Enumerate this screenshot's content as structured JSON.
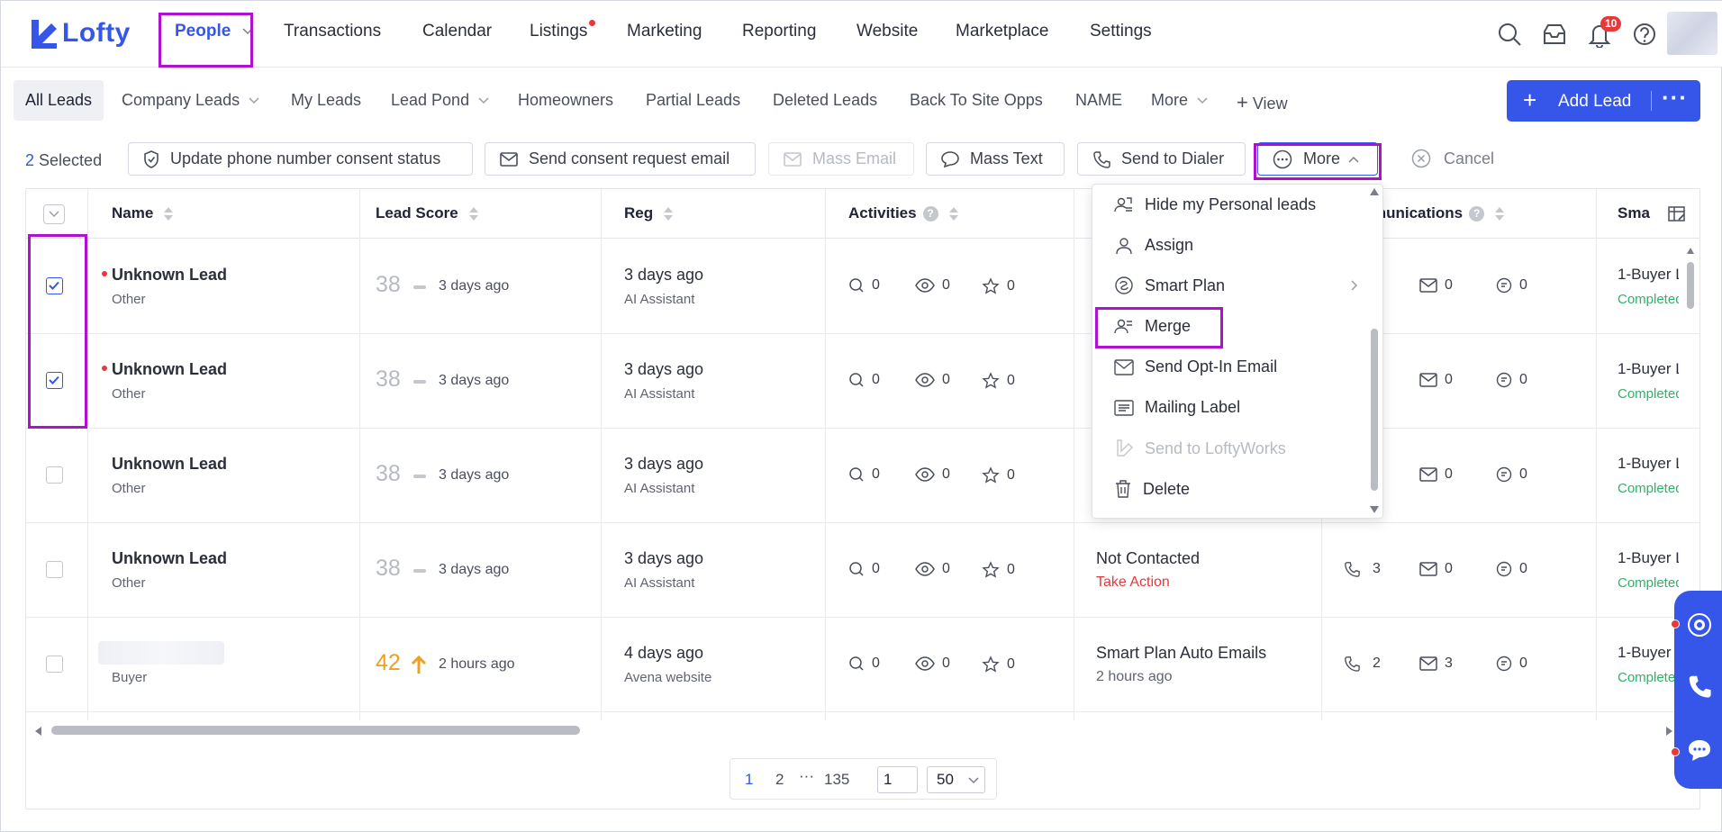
{
  "app": {
    "logo_text": "Lofty"
  },
  "nav": {
    "items": [
      "People",
      "Transactions",
      "Calendar",
      "Listings",
      "Marketing",
      "Reporting",
      "Website",
      "Marketplace",
      "Settings"
    ],
    "notification_count": "10"
  },
  "tabs": [
    "All Leads",
    "Company Leads",
    "My Leads",
    "Lead Pond",
    "Homeowners",
    "Partial Leads",
    "Deleted Leads",
    "Back To Site Opps",
    "NAME",
    "More",
    "View"
  ],
  "add_lead": {
    "label": "Add Lead"
  },
  "actions": {
    "selected_count": "2",
    "selected_label": "Selected",
    "buttons": [
      "Update phone number consent status",
      "Send consent request email",
      "Mass Email",
      "Mass Text",
      "Send to Dialer",
      "More"
    ],
    "cancel": "Cancel"
  },
  "table": {
    "headers": [
      "Name",
      "Lead Score",
      "Reg",
      "Activities",
      "munications",
      "Sma"
    ],
    "rows": [
      {
        "name": "Unknown Lead",
        "type": "Other",
        "score": "38",
        "score_time": "3 days ago",
        "reg": "3 days ago",
        "reg_source": "AI Assistant",
        "act": [
          "0",
          "0",
          "0"
        ],
        "status": "",
        "status_sub": "",
        "comm": [
          "",
          "0",
          "0"
        ],
        "sp": "1-Buyer L",
        "sp_sub": "Completed",
        "checked": true
      },
      {
        "name": "Unknown Lead",
        "type": "Other",
        "score": "38",
        "score_time": "3 days ago",
        "reg": "3 days ago",
        "reg_source": "AI Assistant",
        "act": [
          "0",
          "0",
          "0"
        ],
        "status": "",
        "status_sub": "",
        "comm": [
          "",
          "0",
          "0"
        ],
        "sp": "1-Buyer L",
        "sp_sub": "Completed",
        "checked": true
      },
      {
        "name": "Unknown Lead",
        "type": "Other",
        "score": "38",
        "score_time": "3 days ago",
        "reg": "3 days ago",
        "reg_source": "AI Assistant",
        "act": [
          "0",
          "0",
          "0"
        ],
        "status": "",
        "status_sub": "",
        "comm": [
          "",
          "0",
          "0"
        ],
        "sp": "1-Buyer L",
        "sp_sub": "Completed",
        "checked": false
      },
      {
        "name": "Unknown Lead",
        "type": "Other",
        "score": "38",
        "score_time": "3 days ago",
        "reg": "3 days ago",
        "reg_source": "AI Assistant",
        "act": [
          "0",
          "0",
          "0"
        ],
        "status": "Not Contacted",
        "status_sub": "Take Action",
        "comm": [
          "3",
          "0",
          "0"
        ],
        "sp": "1-Buyer L",
        "sp_sub": "Completed",
        "checked": false
      },
      {
        "name": "",
        "type": "Buyer",
        "score": "42",
        "score_time": "2 hours ago",
        "reg": "4 days ago",
        "reg_source": "Avena website",
        "act": [
          "0",
          "0",
          "0"
        ],
        "status": "Smart Plan Auto Emails",
        "status_sub": "2 hours ago",
        "comm": [
          "2",
          "3",
          "0"
        ],
        "sp": "1-Buyer",
        "sp_sub": "Completed",
        "checked": false
      }
    ]
  },
  "menu": {
    "items": [
      "Hide my Personal leads",
      "Assign",
      "Smart Plan",
      "Merge",
      "Send Opt-In Email",
      "Mailing Label",
      "Send to LoftyWorks",
      "Delete"
    ]
  },
  "pagination": {
    "pages": [
      "1",
      "2",
      "135"
    ],
    "ellipsis": "···",
    "goto": "1",
    "page_size": "50"
  },
  "colors": {
    "primary": "#3556e8",
    "highlight": "#b010d0",
    "danger": "#e5393b",
    "success": "#2fb26a",
    "hot": "#f0a020"
  }
}
